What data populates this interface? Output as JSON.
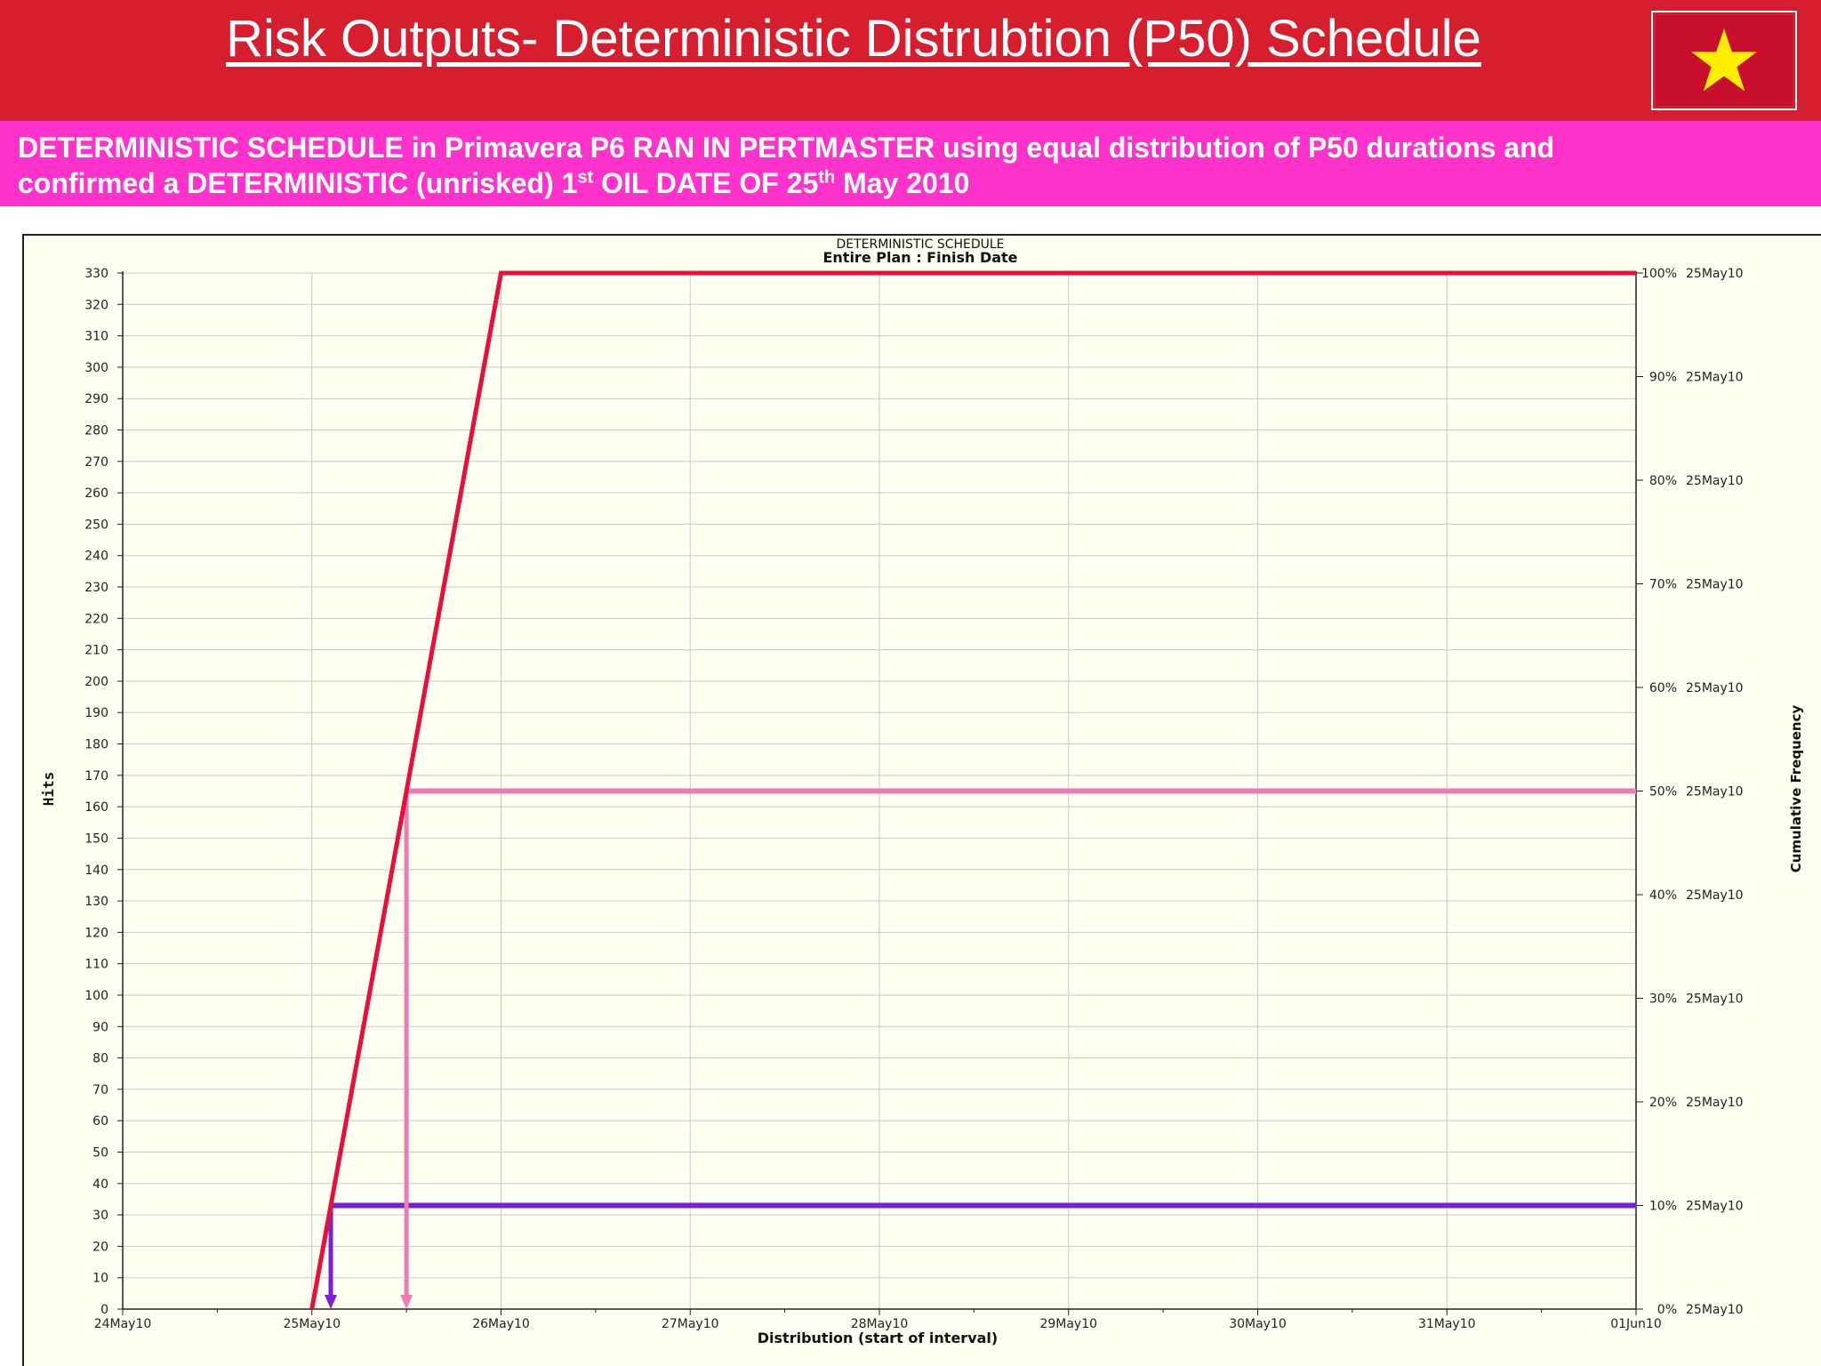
{
  "page": {
    "title": "Risk Outputs-  Deterministic Distrubtion  (P50) Schedule",
    "subtitle_line1": "DETERMINISTIC SCHEDULE in Primavera P6  RAN IN  PERTMASTER  using equal distribution of P50 durations and",
    "subtitle_line2_a": "confirmed a DETERMINISTIC (unrisked) 1",
    "subtitle_line2_sup1": "st",
    "subtitle_line2_b": " OIL DATE OF 25",
    "subtitle_line2_sup2": "th",
    "subtitle_line2_c": " May 2010",
    "flag_icon": "vietnam-flag-star-icon",
    "colors": {
      "header": "#d71e2f",
      "subtitle_band": "#ff33cc",
      "flag": "#c8102e",
      "star": "#ffee00"
    }
  },
  "chart_data": {
    "type": "line",
    "title": "DETERMINISTIC SCHEDULE",
    "subtitle": "Entire Plan : Finish Date",
    "xlabel": "Distribution (start of interval)",
    "ylabel": "Hits",
    "y2label": "Cumulative Frequency",
    "x_ticks": [
      "24May10",
      "25May10",
      "26May10",
      "27May10",
      "28May10",
      "29May10",
      "30May10",
      "31May10",
      "01Jun10"
    ],
    "y_ticks": [
      0,
      10,
      20,
      30,
      40,
      50,
      60,
      70,
      80,
      90,
      100,
      110,
      120,
      130,
      140,
      150,
      160,
      170,
      180,
      190,
      200,
      210,
      220,
      230,
      240,
      250,
      260,
      270,
      280,
      290,
      300,
      310,
      320,
      330
    ],
    "ylim": [
      0,
      330
    ],
    "y2_ticks": [
      {
        "pct": 0,
        "label": "0%",
        "date": "25May10"
      },
      {
        "pct": 10,
        "label": "10%",
        "date": "25May10"
      },
      {
        "pct": 20,
        "label": "20%",
        "date": "25May10"
      },
      {
        "pct": 30,
        "label": "30%",
        "date": "25May10"
      },
      {
        "pct": 40,
        "label": "40%",
        "date": "25May10"
      },
      {
        "pct": 50,
        "label": "50%",
        "date": "25May10"
      },
      {
        "pct": 60,
        "label": "60%",
        "date": "25May10"
      },
      {
        "pct": 70,
        "label": "70%",
        "date": "25May10"
      },
      {
        "pct": 80,
        "label": "80%",
        "date": "25May10"
      },
      {
        "pct": 90,
        "label": "90%",
        "date": "25May10"
      },
      {
        "pct": 100,
        "label": "100%",
        "date": "25May10"
      }
    ],
    "grid": true,
    "series": [
      {
        "color": "#e8103a",
        "x": [
          "25May10 00:00",
          "26May10 00:00",
          "01Jun10 00:00"
        ],
        "cumulative_pct": [
          0,
          100,
          100
        ]
      }
    ],
    "markers": [
      {
        "cumulative_pct": 10,
        "x": "25May10 02:24",
        "color": "#7a1fd6"
      },
      {
        "cumulative_pct": 50,
        "x": "25May10 12:00",
        "color": "#f07ab4"
      }
    ],
    "colors": {
      "background": "#fffff2",
      "grid": "#c8c8c8"
    }
  }
}
